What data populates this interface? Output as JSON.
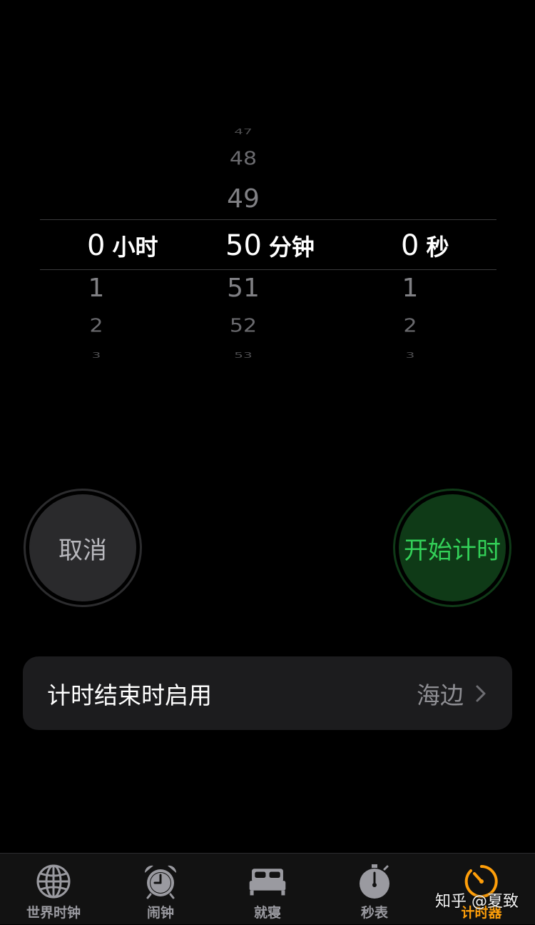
{
  "picker": {
    "hours": {
      "above": [],
      "selected": "0",
      "unit": "小时",
      "below": [
        "1",
        "2",
        "3"
      ]
    },
    "minutes": {
      "above": [
        "47",
        "48",
        "49"
      ],
      "selected": "50",
      "unit": "分钟",
      "below": [
        "51",
        "52",
        "53"
      ]
    },
    "seconds": {
      "above": [],
      "selected": "0",
      "unit": "秒",
      "below": [
        "1",
        "2",
        "3"
      ]
    }
  },
  "buttons": {
    "cancel_label": "取消",
    "start_label": "开始计时"
  },
  "sound": {
    "label": "计时结束时启用",
    "value": "海边"
  },
  "tabs": [
    {
      "label": "世界时钟",
      "icon": "globe-icon"
    },
    {
      "label": "闹钟",
      "icon": "alarm-clock-icon"
    },
    {
      "label": "就寝",
      "icon": "bed-icon"
    },
    {
      "label": "秒表",
      "icon": "stopwatch-icon"
    },
    {
      "label": "计时器",
      "icon": "timer-icon",
      "active": true
    }
  ],
  "watermark": "知乎 @夏致",
  "colors": {
    "background": "#000000",
    "accent": "#ff9f0a",
    "start_green": "#33d058",
    "start_bg": "#0f3a17",
    "cancel_bg": "#2a2a2c",
    "row_bg": "#1c1c1e"
  }
}
